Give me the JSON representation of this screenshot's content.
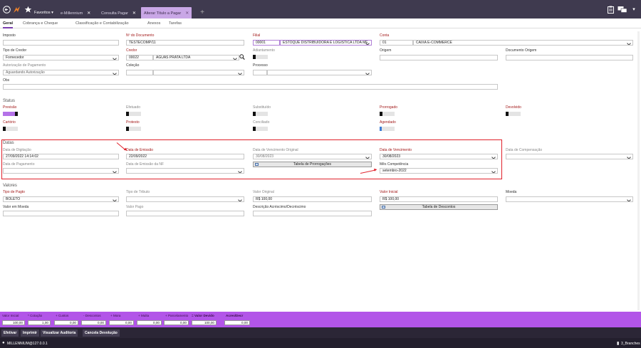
{
  "topbar": {
    "favorites": "Favoritos",
    "tabs": [
      {
        "label": "e-Millennium"
      },
      {
        "label": "Consulta Pagar"
      },
      {
        "label": "Alterar Título a Pagar"
      }
    ]
  },
  "subtabs": [
    "Geral",
    "Cobrança e Cheque",
    "Classificação e Contabilização",
    "Anexos",
    "Tarefas"
  ],
  "form": {
    "imposto": {
      "label": "Imposto",
      "value": ""
    },
    "documento": {
      "label": "Nº do Documento",
      "value": "TESTECOMP/11"
    },
    "filial": {
      "label": "Filial",
      "code": "00001",
      "name": "ESTOQUE DISTRIBUIDORA E LOGISTICA LTDA ME"
    },
    "conta": {
      "label": "Conta",
      "code": "01",
      "name": "CAIXA E-COMMERCE"
    },
    "tipo_credor": {
      "label": "Tipo de Credor",
      "value": "Fornecedor"
    },
    "credor": {
      "label": "Credor",
      "code": "00022",
      "name": "AGUAS PRATA LTDA"
    },
    "adiantamento": {
      "label": "Adiantamento"
    },
    "origem": {
      "label": "Origem",
      "value": ""
    },
    "documento_origem": {
      "label": "Documento Origem",
      "value": ""
    },
    "autorizacao": {
      "label": "Autorização de Pagamento",
      "value": "Aguardando Autorização"
    },
    "colecao": {
      "label": "Coleção"
    },
    "processo": {
      "label": "Processo"
    },
    "obs": {
      "label": "Obs",
      "value": ""
    }
  },
  "status": {
    "title": "Status",
    "items": [
      {
        "label": "Previsão",
        "on": true
      },
      {
        "label": "Efetuado",
        "on": false
      },
      {
        "label": "Substituído",
        "on": false
      },
      {
        "label": "Prorrogado",
        "on": false
      },
      {
        "label": "Devolvido",
        "on": false
      },
      {
        "label": "Cartório",
        "on": false
      },
      {
        "label": "Protesto",
        "on": false
      },
      {
        "label": "Conciliado",
        "on": false
      },
      {
        "label": "Agendado",
        "on": false
      }
    ]
  },
  "datas": {
    "title": "Datas",
    "digitacao": {
      "label": "Data de Digitação",
      "value": "27/09/2022 14:14:02"
    },
    "emissao": {
      "label": "Data de Emissão",
      "value": "22/09/2022"
    },
    "venc_original": {
      "label": "Data de Vencimento Original",
      "value": "30/08/2023"
    },
    "vencimento": {
      "label": "Data de Vencimento",
      "value": "30/08/2023"
    },
    "compensacao": {
      "label": "Data de Compensação",
      "value": ""
    },
    "pagamento": {
      "label": "Data de Pagamento",
      "value": ""
    },
    "emissao_nf": {
      "label": "Data de Emissão da NF",
      "value": ""
    },
    "prorrogacoes_btn": "Tabela de Prorrogações",
    "competencia": {
      "label": "Mês Competência",
      "value": "setembro-2022"
    }
  },
  "valores": {
    "title": "Valores",
    "tipo_pagto": {
      "label": "Tipo de Pagto",
      "value": "BOLETO"
    },
    "tipo_tributo": {
      "label": "Tipo de Tributo",
      "value": ""
    },
    "valor_original": {
      "label": "Valor Original",
      "value": "R$ 100,00"
    },
    "valor_inicial": {
      "label": "Valor Inicial",
      "value": "R$ 100,00"
    },
    "moeda": {
      "label": "Moeda",
      "value": ""
    },
    "valor_moeda": {
      "label": "Valor em Moeda",
      "value": ""
    },
    "valor_pago": {
      "label": "Valor Pago",
      "value": ""
    },
    "descricao_acrescimo": {
      "label": "Descrição Acréscimo/Decréscimo",
      "value": ""
    },
    "descontos_btn": "Tabela de Descontos"
  },
  "totals": [
    {
      "label": "Valor Inicial",
      "value": "100,00"
    },
    {
      "label": "* Cotação",
      "value": "1,00"
    },
    {
      "label": "+ Custos",
      "value": "0,00"
    },
    {
      "label": "- Descontos",
      "value": "0,00"
    },
    {
      "label": "+ Mora",
      "value": "0,00"
    },
    {
      "label": "+ Multa",
      "value": "0,00"
    },
    {
      "label": "+ Parcelamento",
      "value": "0,00"
    },
    {
      "label": "= Valor Devido",
      "value": "100,00"
    },
    {
      "label": "Acres/Decr",
      "value": "0,00"
    }
  ],
  "actions": [
    "Efetivar",
    "Imprimir",
    "Visualizar Auditoria",
    "Cancela Devolução"
  ],
  "statusbar": {
    "user": "MILLENNIUM@127.0.0.1",
    "branch": "3_Branches"
  },
  "colors": {
    "accent": "#b255e8",
    "highlight": "#e0202a",
    "topbar": "#3f3a4f"
  }
}
